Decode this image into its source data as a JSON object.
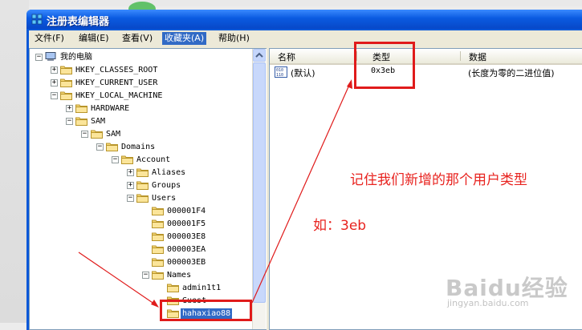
{
  "window": {
    "title": "注册表编辑器"
  },
  "menu": [
    {
      "label": "文件(F)"
    },
    {
      "label": "编辑(E)"
    },
    {
      "label": "查看(V)"
    },
    {
      "label": "收藏夹(A)",
      "active": true
    },
    {
      "label": "帮助(H)"
    }
  ],
  "tree": [
    {
      "label": "我的电脑",
      "level": 0,
      "expander": "-",
      "icon": "computer-icon"
    },
    {
      "label": "HKEY_CLASSES_ROOT",
      "level": 1,
      "expander": "+",
      "icon": "folder-icon"
    },
    {
      "label": "HKEY_CURRENT_USER",
      "level": 1,
      "expander": "+",
      "icon": "folder-icon"
    },
    {
      "label": "HKEY_LOCAL_MACHINE",
      "level": 1,
      "expander": "-",
      "icon": "folder-icon"
    },
    {
      "label": "HARDWARE",
      "level": 2,
      "expander": "+",
      "icon": "folder-icon"
    },
    {
      "label": "SAM",
      "level": 2,
      "expander": "-",
      "icon": "folder-icon"
    },
    {
      "label": "SAM",
      "level": 3,
      "expander": "-",
      "icon": "folder-icon"
    },
    {
      "label": "Domains",
      "level": 4,
      "expander": "-",
      "icon": "folder-icon"
    },
    {
      "label": "Account",
      "level": 5,
      "expander": "-",
      "icon": "folder-icon"
    },
    {
      "label": "Aliases",
      "level": 6,
      "expander": "+",
      "icon": "folder-icon"
    },
    {
      "label": "Groups",
      "level": 6,
      "expander": "+",
      "icon": "folder-icon"
    },
    {
      "label": "Users",
      "level": 6,
      "expander": "-",
      "icon": "folder-icon"
    },
    {
      "label": "000001F4",
      "level": 7,
      "expander": "",
      "icon": "folder-icon"
    },
    {
      "label": "000001F5",
      "level": 7,
      "expander": "",
      "icon": "folder-icon"
    },
    {
      "label": "000003E8",
      "level": 7,
      "expander": "",
      "icon": "folder-icon"
    },
    {
      "label": "000003EA",
      "level": 7,
      "expander": "",
      "icon": "folder-icon"
    },
    {
      "label": "000003EB",
      "level": 7,
      "expander": "",
      "icon": "folder-icon"
    },
    {
      "label": "Names",
      "level": 7,
      "expander": "-",
      "icon": "folder-icon"
    },
    {
      "label": "admin1t1",
      "level": 8,
      "expander": "",
      "icon": "folder-icon"
    },
    {
      "label": "Guest",
      "level": 8,
      "expander": "",
      "icon": "folder-icon"
    },
    {
      "label": "hahaxiao88",
      "level": 8,
      "expander": "",
      "icon": "folder-icon",
      "selected": true
    }
  ],
  "list": {
    "columns": [
      {
        "label": "名称"
      },
      {
        "label": "类型"
      },
      {
        "label": "数据"
      }
    ],
    "rows": [
      {
        "name": "(默认)",
        "type": "0x3eb",
        "data": "(长度为零的二进位值)",
        "icon": "binary-value-icon"
      }
    ]
  },
  "annotations": {
    "note": "记住我们新增的那个用户类型",
    "example": "如：3eb"
  },
  "watermark": {
    "brand": "Baidu经验",
    "url": "jingyan.baidu.com"
  },
  "colors": {
    "accent": "#316ac5",
    "annotation": "#e01b1b",
    "titlebar": "#0a5ae0"
  }
}
